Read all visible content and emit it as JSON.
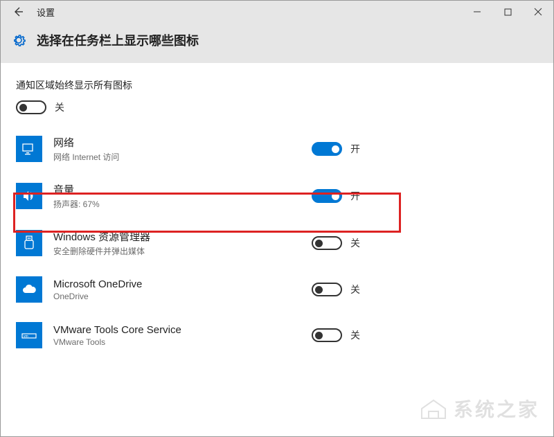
{
  "window": {
    "title": "设置"
  },
  "page_title": "选择在任务栏上显示哪些图标",
  "section_heading": "通知区域始终显示所有图标",
  "master_toggle": {
    "state_label": "关"
  },
  "items": [
    {
      "title": "网络",
      "sub": "网络 Internet 访问",
      "state_label": "开"
    },
    {
      "title": "音量",
      "sub": "扬声器: 67%",
      "state_label": "开"
    },
    {
      "title": "Windows 资源管理器",
      "sub": "安全删除硬件并弹出媒体",
      "state_label": "关"
    },
    {
      "title": "Microsoft OneDrive",
      "sub": "OneDrive",
      "state_label": "关"
    },
    {
      "title": "VMware Tools Core Service",
      "sub": "VMware Tools",
      "state_label": "关"
    }
  ],
  "watermark": "系统之家"
}
